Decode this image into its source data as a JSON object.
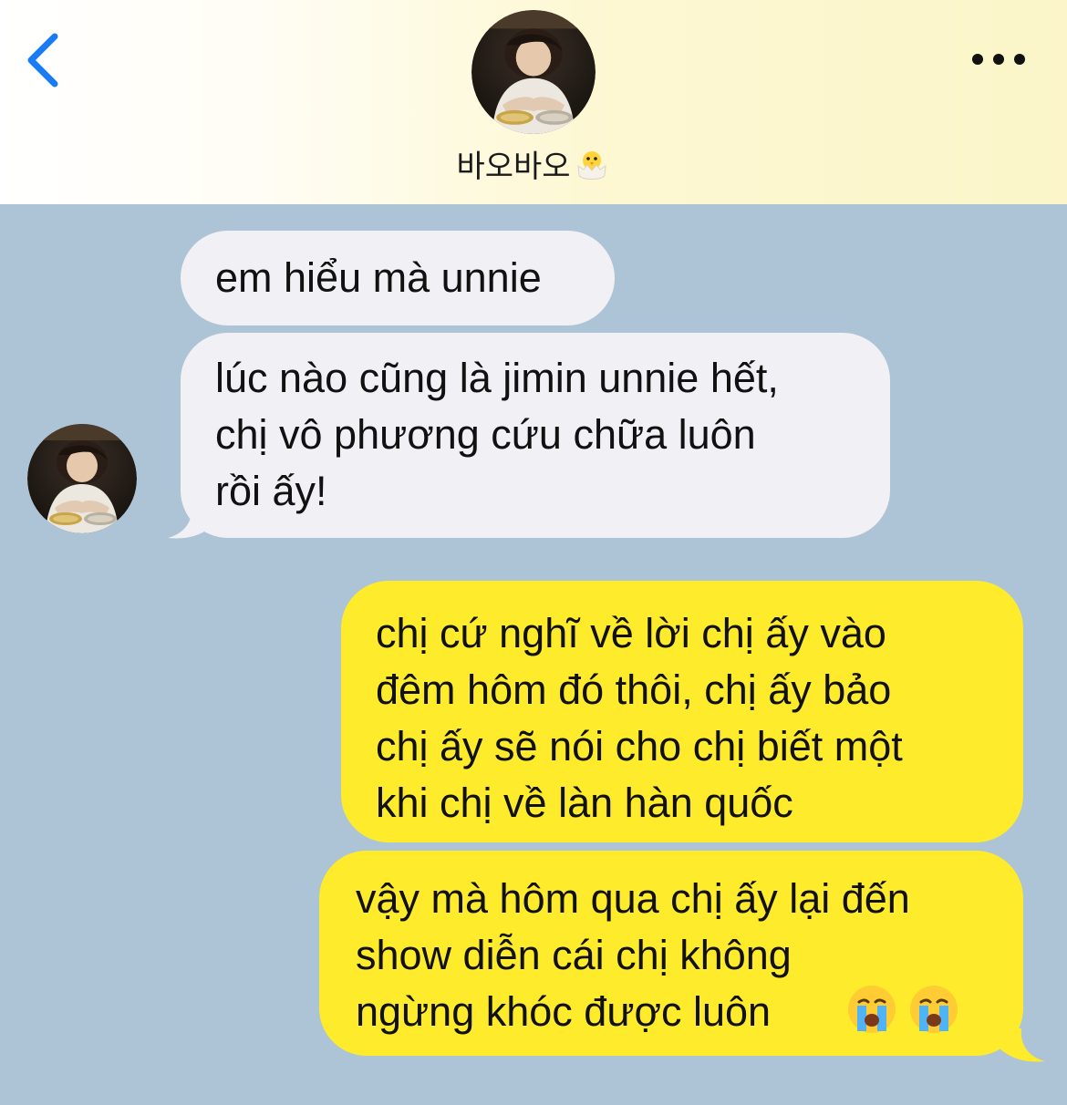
{
  "header": {
    "contact_name": "바오바오",
    "back_icon": "chevron-left-icon",
    "more_icon": "ellipsis-icon",
    "chick_emoji": "hatching-chick-icon"
  },
  "messages": [
    {
      "side": "received",
      "text": "em hiểu mà unnie"
    },
    {
      "side": "received",
      "text": "lúc nào cũng là jimin unnie hết,\nchị vô phương cứu chữa luôn\nrồi ấy!"
    },
    {
      "side": "sent",
      "text": "chị cứ nghĩ về lời chị ấy vào\nđêm hôm đó thôi, chị ấy bảo\nchị ấy sẽ nói cho chị biết một\nkhi chị về làn hàn quốc"
    },
    {
      "side": "sent",
      "text": "vậy mà hôm qua chị ấy lại đến\nshow diễn cái chị không\nngừng khóc được luôn",
      "emojis": [
        "loudly-crying-face-icon",
        "loudly-crying-face-icon"
      ]
    }
  ],
  "colors": {
    "chat_background": "#adc4d6",
    "received_bubble": "#f1f1f5",
    "sent_bubble": "#feeb2c",
    "accent": "#1a7cf5"
  }
}
